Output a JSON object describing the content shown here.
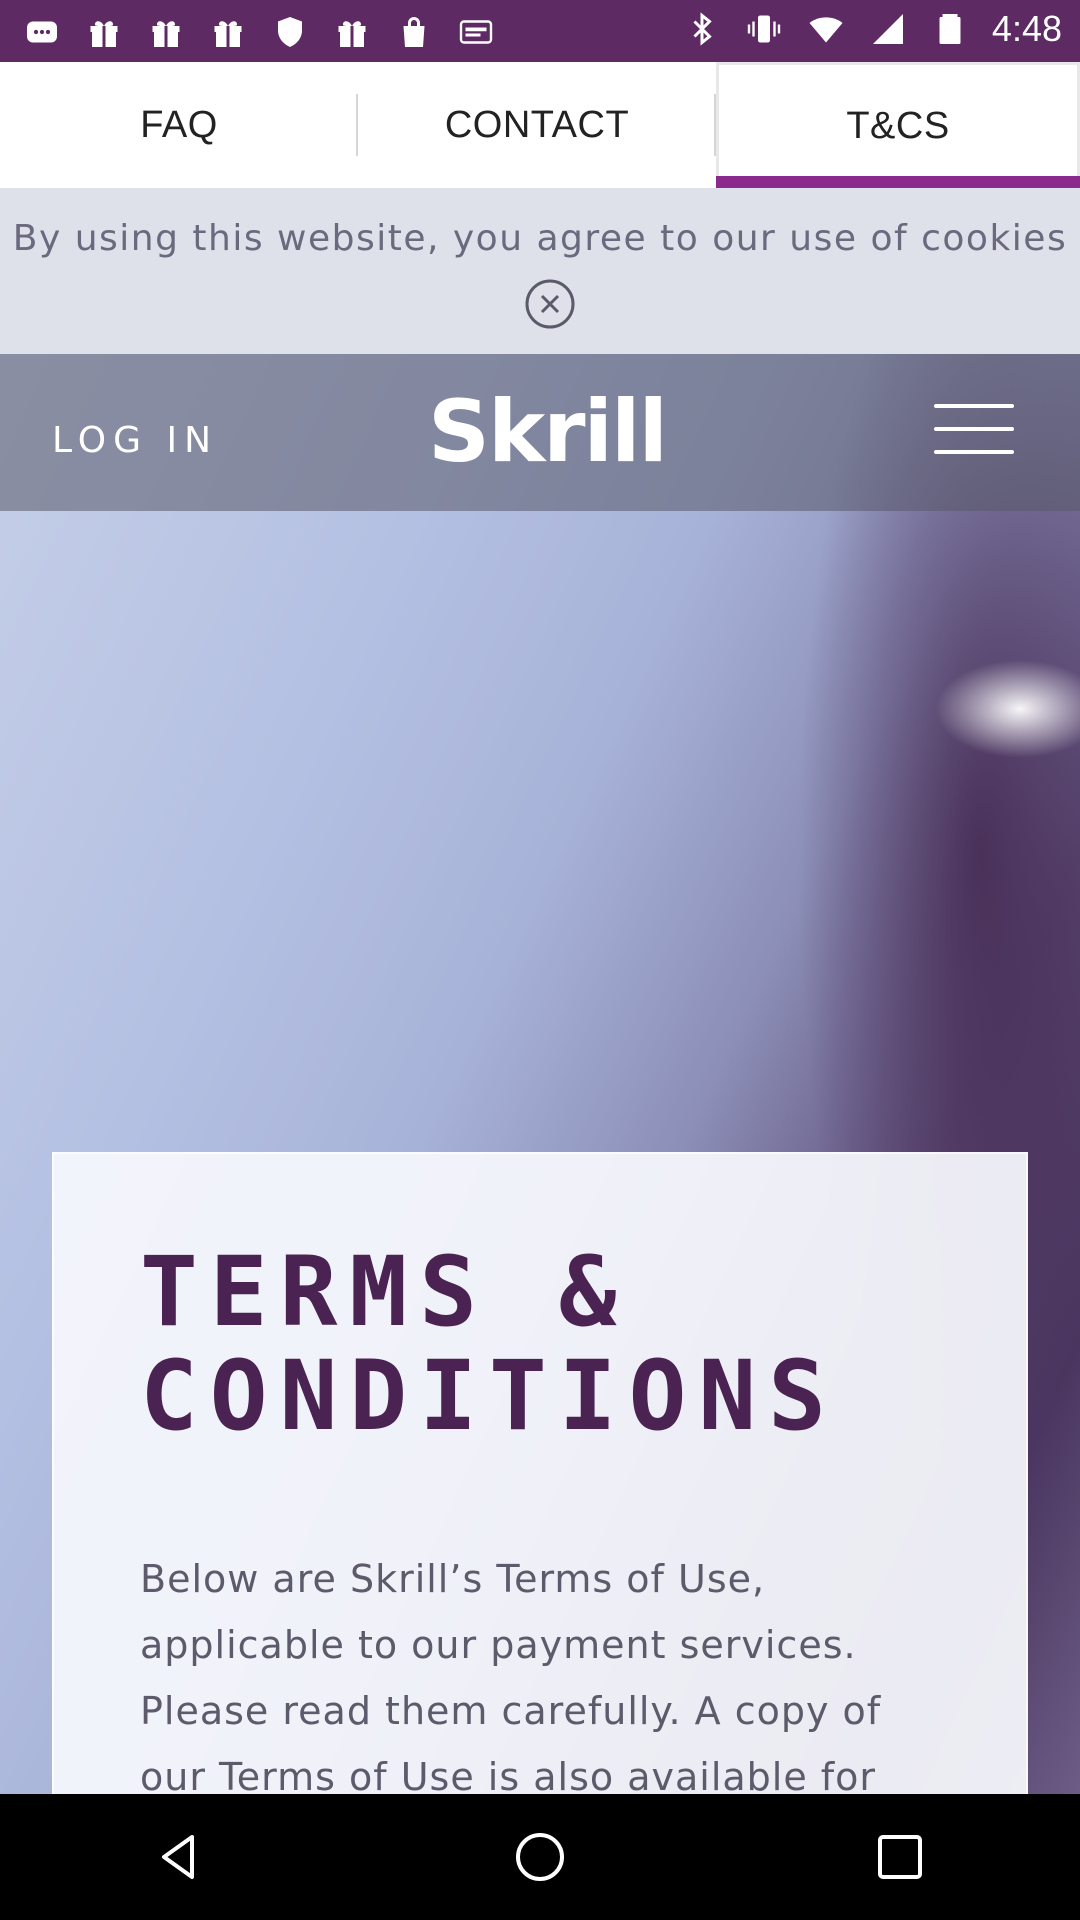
{
  "status_bar": {
    "time": "4:48",
    "bg_color": "#5e2a63",
    "icons": [
      "message-icon",
      "gift-icon",
      "gift-icon",
      "gift-icon",
      "shield-icon",
      "gift-icon",
      "shopping-bag-icon",
      "espn-dallas-icon",
      "bluetooth-icon",
      "vibrate-icon",
      "wifi-icon",
      "signal-icon",
      "battery-icon"
    ]
  },
  "tabs": {
    "items": [
      {
        "label": "FAQ"
      },
      {
        "label": "CONTACT"
      },
      {
        "label": "T&CS"
      }
    ],
    "active_index": 2,
    "accent_color": "#8b2a8c"
  },
  "cookie_banner": {
    "text": "By using this website, you agree to our use of cookies",
    "close_icon": "close-circle-icon"
  },
  "header": {
    "login_label": "LOG IN",
    "logo_text": "Skrill",
    "menu_icon": "hamburger-menu-icon"
  },
  "card": {
    "title": "TERMS &\nCONDITIONS",
    "body": "Below are Skrill’s Terms of Use, applicable to our payment services. Please read them carefully. A copy of our Terms of Use is also available for",
    "title_color": "#4b2353"
  },
  "nav_bar": {
    "icons": [
      "back-icon",
      "home-icon",
      "recents-icon"
    ]
  }
}
